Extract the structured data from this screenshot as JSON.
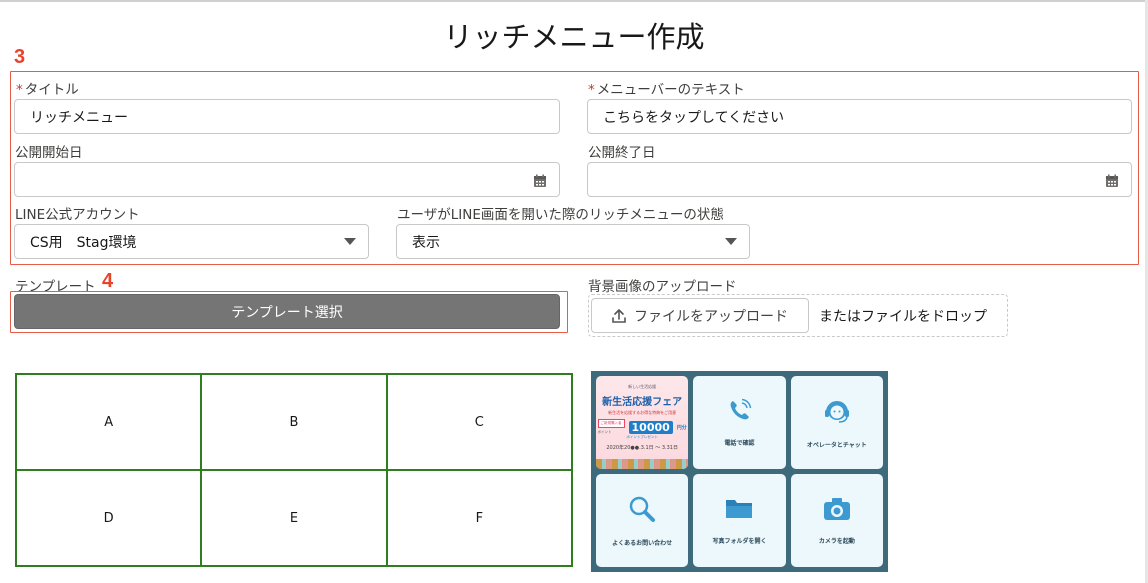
{
  "page": {
    "title": "リッチメニュー作成"
  },
  "annotations": {
    "section_fields": "3",
    "section_template": "4"
  },
  "form": {
    "title_label": "タイトル",
    "title_value": "リッチメニュー",
    "menubar_label": "メニューバーのテキスト",
    "menubar_value": "こちらをタップしてください",
    "start_date_label": "公開開始日",
    "start_date_value": "",
    "end_date_label": "公開終了日",
    "end_date_value": "",
    "account_label": "LINE公式アカウント",
    "account_value": "CS用　Stag環境",
    "state_label": "ユーザがLINE画面を開いた際のリッチメニューの状態",
    "state_value": "表示",
    "required_mark": "*"
  },
  "template": {
    "label": "テンプレート",
    "button_label": "テンプレート選択",
    "cells": [
      "A",
      "B",
      "C",
      "D",
      "E",
      "F"
    ]
  },
  "upload": {
    "label": "背景画像のアップロード",
    "button_label": "ファイルをアップロード",
    "drop_text": "またはファイルをドロップ"
  },
  "preview": {
    "banner_top": "新しい生活応援",
    "banner_title": "新生活応援フェア",
    "banner_sub": "新生活を応援するお得な特典をご用意",
    "banner_box1": "ご新規購入者",
    "banner_box2": "ポイント",
    "banner_amount": "10000",
    "banner_yen": "円分",
    "banner_amount_sub": "ポイントプレゼント",
    "banner_dates": "2020年20●●.3.1日 ～ 3.31日",
    "tiles": [
      "電話で確認",
      "オペレータとチャット",
      "よくあるお問い合わせ",
      "写真フォルダを開く",
      "カメラを起動"
    ],
    "tile_icons": [
      "phone-icon",
      "headset-icon",
      "magnifier-icon",
      "folder-icon",
      "camera-icon"
    ],
    "colors": {
      "background": "#3e6b7c",
      "tile": "#ecf8fb",
      "icon": "#3d9ad1"
    }
  }
}
